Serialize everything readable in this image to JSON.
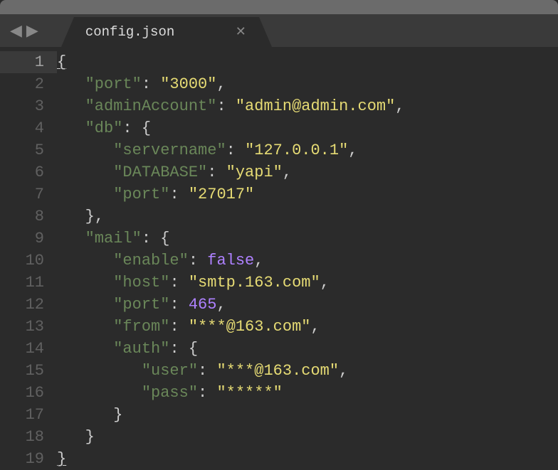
{
  "tab": {
    "title": "config.json"
  },
  "lineNumbers": [
    "1",
    "2",
    "3",
    "4",
    "5",
    "6",
    "7",
    "8",
    "9",
    "10",
    "11",
    "12",
    "13",
    "14",
    "15",
    "16",
    "17",
    "18",
    "19"
  ],
  "activeLine": 1,
  "code": {
    "port": "3000",
    "adminAccount": "admin@admin.com",
    "db": {
      "servername": "127.0.0.1",
      "DATABASE": "yapi",
      "port": "27017"
    },
    "mail": {
      "enable": false,
      "host": "smtp.163.com",
      "port": 465,
      "from": "***@163.com",
      "auth": {
        "user": "***@163.com",
        "pass": "*****"
      }
    }
  },
  "tokens": {
    "l1": {
      "brace": "{"
    },
    "l2": {
      "key": "\"port\"",
      "string": "\"3000\""
    },
    "l3": {
      "key": "\"adminAccount\"",
      "string": "\"admin@admin.com\""
    },
    "l4": {
      "key": "\"db\"",
      "brace": "{"
    },
    "l5": {
      "key": "\"servername\"",
      "string": "\"127.0.0.1\""
    },
    "l6": {
      "key": "\"DATABASE\"",
      "string": "\"yapi\""
    },
    "l7": {
      "key": "\"port\"",
      "string": "\"27017\""
    },
    "l8": {
      "brace": "}"
    },
    "l9": {
      "key": "\"mail\"",
      "brace": "{"
    },
    "l10": {
      "key": "\"enable\"",
      "bool": "false"
    },
    "l11": {
      "key": "\"host\"",
      "string": "\"smtp.163.com\""
    },
    "l12": {
      "key": "\"port\"",
      "num": "465"
    },
    "l13": {
      "key": "\"from\"",
      "string": "\"***@163.com\""
    },
    "l14": {
      "key": "\"auth\"",
      "brace": "{"
    },
    "l15": {
      "key": "\"user\"",
      "string": "\"***@163.com\""
    },
    "l16": {
      "key": "\"pass\"",
      "string": "\"*****\""
    },
    "l17": {
      "brace": "}"
    },
    "l18": {
      "brace": "}"
    },
    "l19": {
      "brace": "}"
    }
  }
}
